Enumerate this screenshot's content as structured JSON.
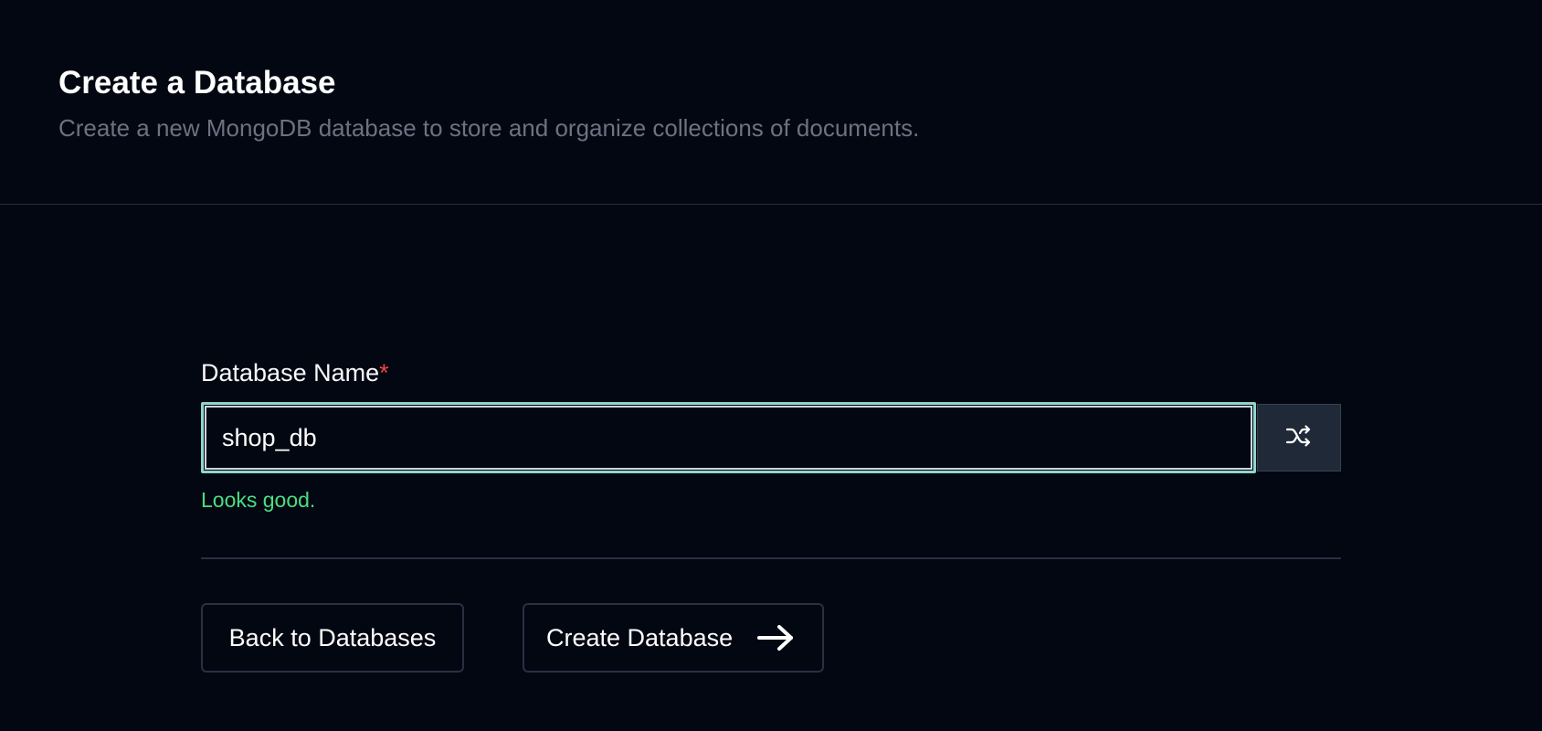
{
  "header": {
    "title": "Create a Database",
    "subtitle": "Create a new MongoDB database to store and organize collections of documents."
  },
  "form": {
    "label": "Database Name",
    "required_mark": "*",
    "input_value": "shop_db",
    "validation_message": "Looks good.",
    "shuffle_icon": "shuffle-icon"
  },
  "actions": {
    "back_label": "Back to Databases",
    "create_label": "Create Database",
    "create_icon": "arrow-right-icon"
  },
  "colors": {
    "background": "#030712",
    "success": "#4ade80",
    "required": "#ef4444",
    "muted_text": "#6b7280"
  }
}
